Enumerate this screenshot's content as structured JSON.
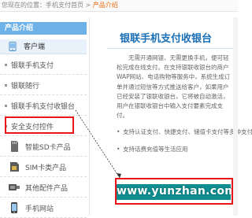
{
  "breadcrumb": {
    "home": "您现在的位置：",
    "path1": "手机支付首页",
    "sep": " > ",
    "current": "产品介绍"
  },
  "sidebar": {
    "header": "产品介绍",
    "client_label": "客户端",
    "subitems": [
      {
        "label": "银联手机支付"
      },
      {
        "label": "银联随行"
      },
      {
        "label": "银联手机支付收银台"
      },
      {
        "label": "安全支付控件"
      }
    ],
    "categories": [
      {
        "label": "智能SD卡产品",
        "icon": "sd-card-icon"
      },
      {
        "label": "SIM卡类产品",
        "icon": "sim-card-icon"
      },
      {
        "label": "其他配件产品",
        "icon": "accessory-icon"
      },
      {
        "label": "手机网站",
        "icon": "mobile-site-icon"
      }
    ]
  },
  "main": {
    "title": "银联手机支付收银台",
    "description": "无需开通网银、无需更换手机，便可轻松完成在线支付。在支持银联收银台的商户WAP网站、电话购物等服务中，系统生成订单并通过短信等方式推送给客户，如果用户已经安装了银联收银台，它将被自动激活，用户在银联收银台中输入支付要素完成支付。",
    "bullets": [
      "支持认证支付、快捷支付、储值卡支付等多种支付方式",
      "支持话费充值等生活应用"
    ],
    "watermark": "www.yunzhan.com"
  },
  "colors": {
    "accent_blue": "#1b6fb4",
    "highlight_red": "#e8151b",
    "sidebar_header": "#6fb2e8",
    "teal": "#0f8e90"
  }
}
